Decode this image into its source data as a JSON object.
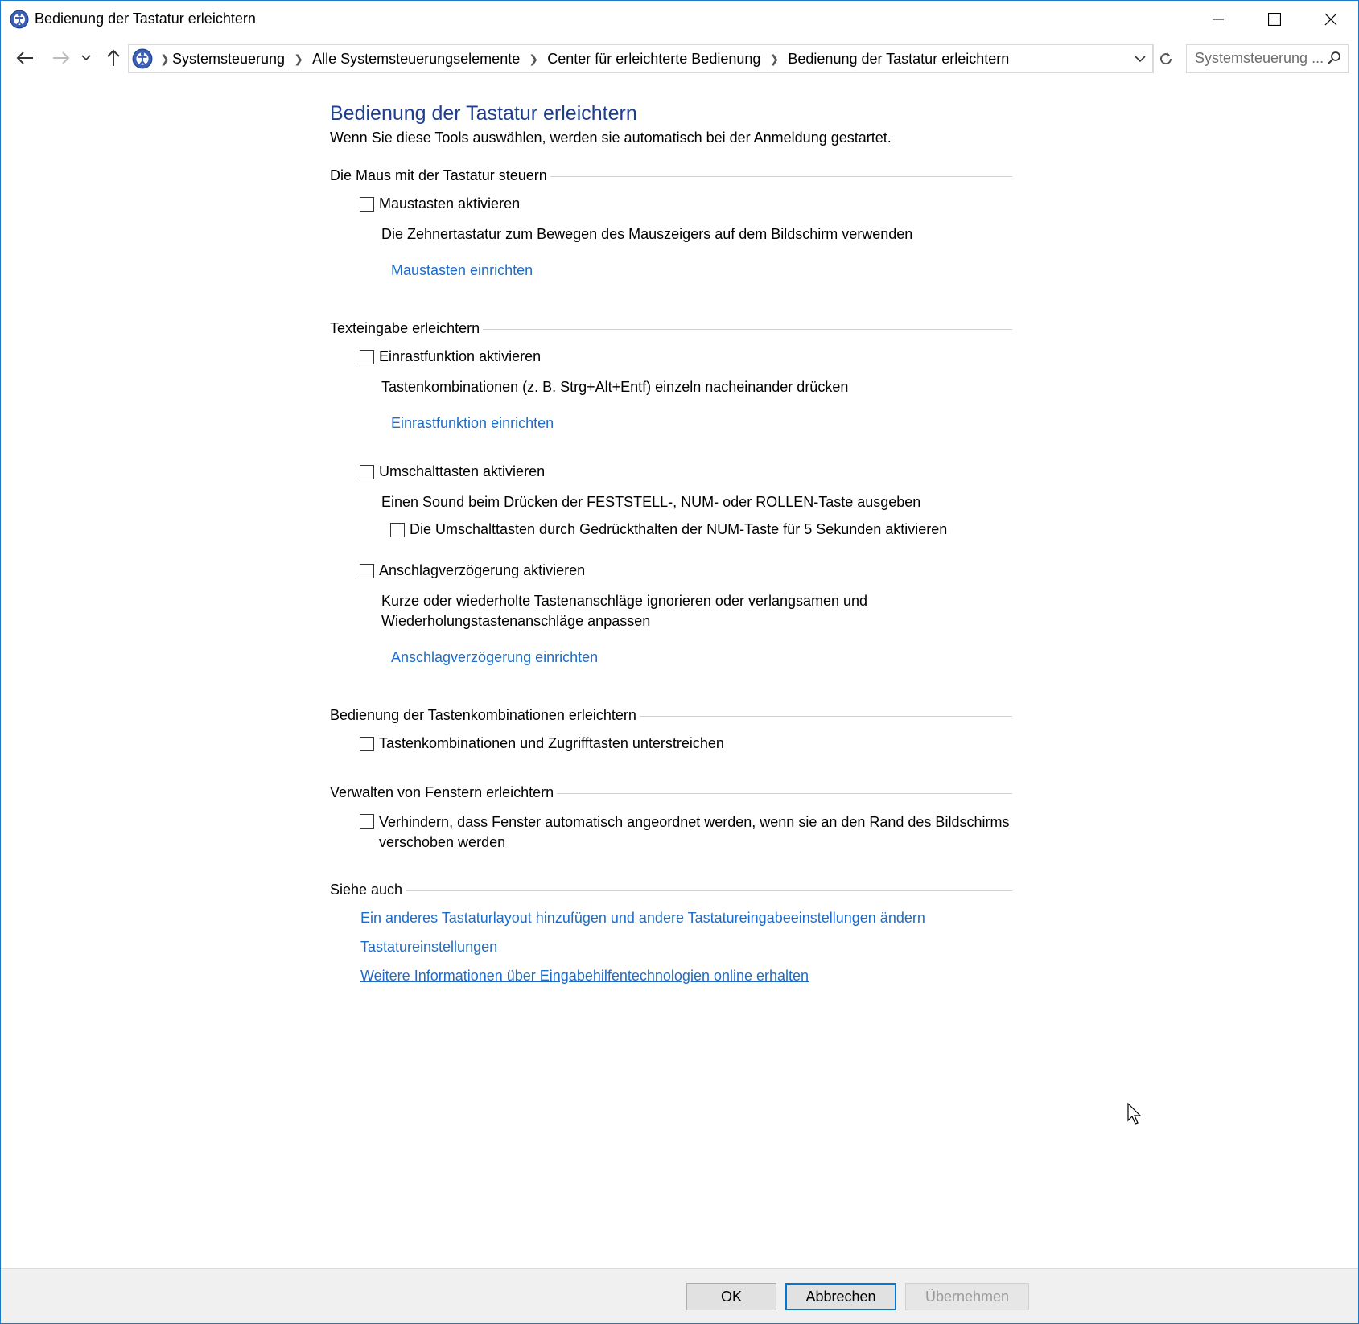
{
  "window": {
    "title": "Bedienung der Tastatur erleichtern",
    "accent_color": "#1979ca"
  },
  "icons": {
    "app": "control-panel-icon",
    "back": "back-arrow-icon",
    "forward": "forward-arrow-icon",
    "recent": "chevron-down-icon",
    "up": "up-arrow-icon",
    "refresh": "refresh-icon",
    "search": "search-icon",
    "minimize": "minimize-icon",
    "maximize": "maximize-icon",
    "close": "close-icon"
  },
  "breadcrumb": {
    "items": [
      "Systemsteuerung",
      "Alle Systemsteuerungselemente",
      "Center für erleichterte Bedienung",
      "Bedienung der Tastatur erleichtern"
    ]
  },
  "search": {
    "placeholder": "Systemsteuerung ..."
  },
  "page": {
    "title": "Bedienung der Tastatur erleichtern",
    "description": "Wenn Sie diese Tools auswählen, werden sie automatisch bei der Anmeldung gestartet.",
    "title_color": "#1e3f8f",
    "link_color": "#1e6cc8"
  },
  "groups": {
    "mouse": {
      "heading": "Die Maus mit der Tastatur steuern",
      "mousekeys_label": "Maustasten aktivieren",
      "mousekeys_checked": false,
      "mousekeys_desc": "Die Zehnertastatur zum Bewegen des Mauszeigers auf dem Bildschirm verwenden",
      "mousekeys_link": "Maustasten einrichten"
    },
    "typing": {
      "heading": "Texteingabe erleichtern",
      "sticky_label": "Einrastfunktion aktivieren",
      "sticky_checked": false,
      "sticky_desc": "Tastenkombinationen (z. B. Strg+Alt+Entf) einzeln nacheinander drücken",
      "sticky_link": "Einrastfunktion einrichten",
      "toggle_label": "Umschalttasten aktivieren",
      "toggle_checked": false,
      "toggle_desc": "Einen Sound beim Drücken der FESTSTELL-, NUM- oder ROLLEN-Taste ausgeben",
      "toggle_sub_label": "Die Umschalttasten durch Gedrückthalten der NUM-Taste für 5 Sekunden aktivieren",
      "toggle_sub_checked": false,
      "filter_label": "Anschlagverzögerung aktivieren",
      "filter_checked": false,
      "filter_desc_line1": "Kurze oder wiederholte Tastenanschläge ignorieren oder verlangsamen und",
      "filter_desc_line2": "Wiederholungstastenanschläge anpassen",
      "filter_link": "Anschlagverzögerung einrichten"
    },
    "shortcuts": {
      "heading": "Bedienung der Tastenkombinationen erleichtern",
      "underline_label": "Tastenkombinationen und Zugrifftasten unterstreichen",
      "underline_checked": false
    },
    "windows": {
      "heading": "Verwalten von Fenstern erleichtern",
      "snap_label_line1": "Verhindern, dass Fenster automatisch angeordnet werden, wenn sie an den Rand des Bildschirms",
      "snap_label_line2": "verschoben werden",
      "snap_checked": false
    },
    "see_also": {
      "heading": "Siehe auch",
      "links": [
        "Ein anderes Tastaturlayout hinzufügen und andere Tastatureingabeeinstellungen ändern",
        "Tastatureinstellungen",
        "Weitere Informationen über Eingabehilfentechnologien online erhalten"
      ]
    }
  },
  "footer": {
    "ok": "OK",
    "cancel": "Abbrechen",
    "apply": "Übernehmen",
    "apply_enabled": false
  }
}
